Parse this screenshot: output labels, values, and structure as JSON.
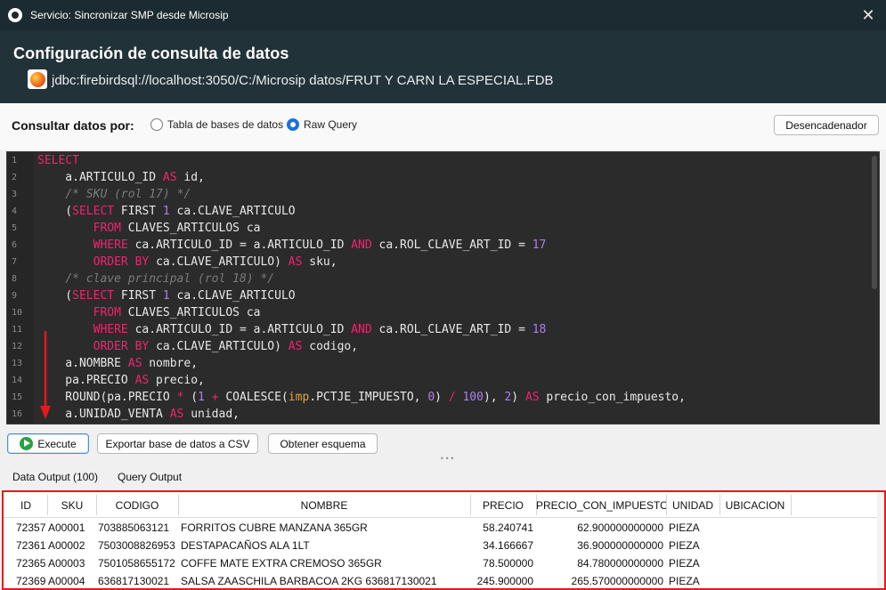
{
  "window": {
    "title": "Servicio: Sincronizar SMP desde Microsip",
    "close_symbol": "✕"
  },
  "header": {
    "title": "Configuración de consulta de datos",
    "connection": "jdbc:firebirdsql://localhost:3050/C:/Microsip datos/FRUT Y CARN LA ESPECIAL.FDB"
  },
  "mode": {
    "label": "Consultar datos por:",
    "option_table": "Tabla de bases de datos",
    "option_raw": "Raw Query",
    "selected": "Raw Query",
    "trigger_button": "Desencadenador"
  },
  "editor": {
    "lines": [
      {
        "n": "1"
      },
      {
        "n": "2"
      },
      {
        "n": "3"
      },
      {
        "n": "4"
      },
      {
        "n": "5"
      },
      {
        "n": "6"
      },
      {
        "n": "7"
      },
      {
        "n": "8"
      },
      {
        "n": "9"
      },
      {
        "n": "10"
      },
      {
        "n": "11"
      },
      {
        "n": "12"
      },
      {
        "n": "13"
      },
      {
        "n": "14"
      },
      {
        "n": "15"
      },
      {
        "n": "16"
      }
    ]
  },
  "actions": {
    "execute": "Execute",
    "export_csv": "Exportar base de datos a CSV",
    "get_schema": "Obtener esquema"
  },
  "tabs": {
    "data_output": "Data Output (100)",
    "query_output": "Query Output"
  },
  "results": {
    "columns": [
      "ID",
      "SKU",
      "CODIGO",
      "NOMBRE",
      "PRECIO",
      "PRECIO_CON_IMPUESTO",
      "UNIDAD",
      "UBICACION"
    ],
    "rows": [
      [
        "72357",
        "A00001",
        "703885063121",
        "FORRITOS CUBRE MANZANA 365GR",
        "58.240741",
        "62.900000000000",
        "PIEZA",
        ""
      ],
      [
        "72361",
        "A00002",
        "7503008826953",
        "DESTAPACAÑOS ALA 1LT",
        "34.166667",
        "36.900000000000",
        "PIEZA",
        ""
      ],
      [
        "72365",
        "A00003",
        "7501058655172",
        "COFFE MATE EXTRA CREMOSO 365GR",
        "78.500000",
        "84.780000000000",
        "PIEZA",
        ""
      ],
      [
        "72369",
        "A00004",
        "636817130021",
        "SALSA ZAASCHILA BARBACOA 2KG 636817130021",
        "245.900000",
        "265.570000000000",
        "PIEZA",
        ""
      ]
    ]
  },
  "colors": {
    "titlebar": "#1c2b31",
    "header": "#223239",
    "editor_bg": "#2b2b2b",
    "keyword": "#f0246e",
    "number": "#ad7ff0",
    "comment": "#7b7b7b",
    "function": "#e3a43c",
    "highlight_border": "#e81818",
    "arrow": "#e81818"
  }
}
